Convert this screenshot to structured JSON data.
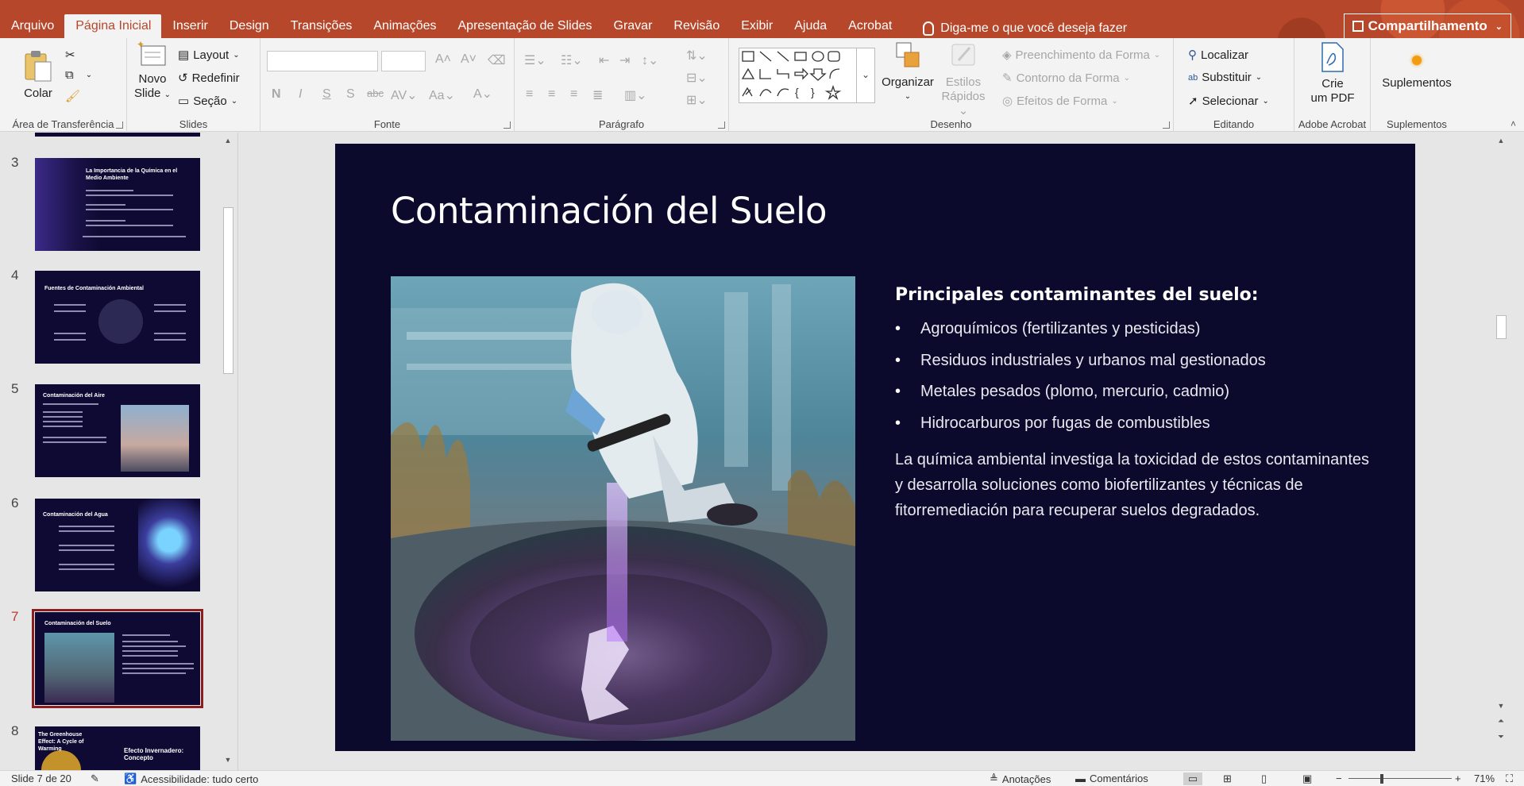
{
  "tabs": [
    "Arquivo",
    "Página Inicial",
    "Inserir",
    "Design",
    "Transições",
    "Animações",
    "Apresentação de Slides",
    "Gravar",
    "Revisão",
    "Exibir",
    "Ajuda",
    "Acrobat"
  ],
  "active_tab": "Página Inicial",
  "tell_me": "Diga-me o que você deseja fazer",
  "share_label": "Compartilhamento",
  "ribbon": {
    "clipboard": {
      "paste": "Colar",
      "label": "Área de Transferência"
    },
    "slides": {
      "new_slide_1": "Novo",
      "new_slide_2": "Slide",
      "layout": "Layout",
      "reset": "Redefinir",
      "section": "Seção",
      "label": "Slides"
    },
    "font": {
      "label": "Fonte"
    },
    "paragraph": {
      "label": "Parágrafo"
    },
    "drawing": {
      "arrange": "Organizar",
      "quick_styles_1": "Estilos",
      "quick_styles_2": "Rápidos",
      "shape_fill": "Preenchimento da Forma",
      "shape_outline": "Contorno da Forma",
      "shape_effects": "Efeitos de Forma",
      "label": "Desenho"
    },
    "editing": {
      "find": "Localizar",
      "replace": "Substituir",
      "select": "Selecionar",
      "label": "Editando"
    },
    "acrobat": {
      "create_1": "Crie",
      "create_2": "um PDF",
      "label": "Adobe Acrobat"
    },
    "addins": {
      "button": "Suplementos",
      "label": "Suplementos"
    }
  },
  "thumbnails": [
    {
      "num": "3",
      "title": "La Importancia de la Química en el Medio Ambiente"
    },
    {
      "num": "4",
      "title": "Fuentes de Contaminación Ambiental"
    },
    {
      "num": "5",
      "title": "Contaminación del Aire"
    },
    {
      "num": "6",
      "title": "Contaminación del Agua"
    },
    {
      "num": "7",
      "title": "Contaminación del Suelo"
    },
    {
      "num": "8",
      "title": "Efecto Invernadero: Concepto",
      "side_title": "The Greenhouse Effect: A Cycle of Warming"
    }
  ],
  "slide": {
    "title": "Contaminación del Suelo",
    "subtitle": "Principales contaminantes del suelo:",
    "bullets": [
      "Agroquímicos (fertilizantes y pesticidas)",
      "Residuos industriales y urbanos mal gestionados",
      "Metales pesados (plomo, mercurio, cadmio)",
      "Hidrocarburos por fugas de combustibles"
    ],
    "paragraph": "La química ambiental investiga la toxicidad de estos contaminantes y desarrolla soluciones como biofertilizantes y técnicas de fitorremediación para recuperar suelos degradados."
  },
  "status": {
    "slide_counter": "Slide 7 de 20",
    "accessibility": "Acessibilidade: tudo certo",
    "notes": "Anotações",
    "comments": "Comentários",
    "zoom": "71%"
  },
  "colors": {
    "accent": "#b7472a",
    "slide_bg": "#0c0a2c",
    "selected_thumb_border": "#8b1f1f"
  }
}
